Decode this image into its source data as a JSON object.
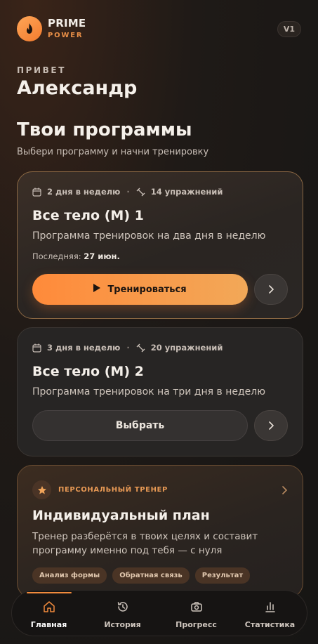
{
  "brand": {
    "title": "PRIME",
    "subtitle": "POWER",
    "version": "V1"
  },
  "greeting": {
    "hello": "ПРИВЕТ",
    "name": "Александр"
  },
  "section": {
    "title": "Твои программы",
    "subtitle": "Выбери программу и начни тренировку"
  },
  "programs": [
    {
      "days": "2 дня в неделю",
      "exercises": "14 упражнений",
      "title": "Все тело (М) 1",
      "description": "Программа тренировок на два дня в неделю",
      "last_label": "Последняя:",
      "last_value": "27 июн.",
      "action": "Тренироваться"
    },
    {
      "days": "3 дня в неделю",
      "exercises": "20 упражнений",
      "title": "Все тело (М) 2",
      "description": "Программа тренировок на три дня в неделю",
      "action": "Выбрать"
    }
  ],
  "coach": {
    "label": "ПЕРСОНАЛЬНЫЙ ТРЕНЕР",
    "title": "Индивидуальный план",
    "description": "Тренер разберётся в твоих целях и составит программу именно под тебя — с нуля",
    "tags": [
      "Анализ формы",
      "Обратная связь",
      "Результат"
    ]
  },
  "nav": [
    {
      "label": "Главная",
      "icon": "home-icon",
      "active": true
    },
    {
      "label": "История",
      "icon": "history-icon",
      "active": false
    },
    {
      "label": "Прогресс",
      "icon": "camera-icon",
      "active": false
    },
    {
      "label": "Статистика",
      "icon": "bar-chart-icon",
      "active": false
    }
  ],
  "colors": {
    "accent": "#f08a3c",
    "background": "#161514"
  }
}
